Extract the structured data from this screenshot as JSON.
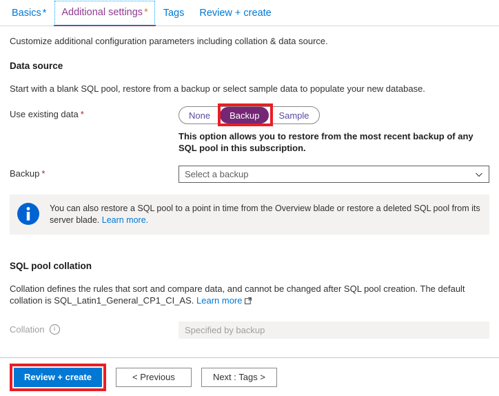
{
  "tabs": [
    {
      "label": "Basics",
      "required": true,
      "selected": false
    },
    {
      "label": "Additional settings",
      "required": true,
      "selected": true
    },
    {
      "label": "Tags",
      "required": false,
      "selected": false
    },
    {
      "label": "Review + create",
      "required": false,
      "selected": false
    }
  ],
  "intro": "Customize additional configuration parameters including collation & data source.",
  "data_source": {
    "heading": "Data source",
    "description": "Start with a blank SQL pool, restore from a backup or select sample data to populate your new database.",
    "use_existing_data": {
      "label": "Use existing data",
      "required_marker": "*",
      "options": [
        "None",
        "Backup",
        "Sample"
      ],
      "selected": "Backup",
      "help_text": "This option allows you to restore from the most recent backup of any SQL pool in this subscription.",
      "highlight_color": "#ec1c24",
      "selected_color": "#742774"
    },
    "backup": {
      "label": "Backup",
      "required_marker": "*",
      "placeholder": "Select a backup",
      "value": "Select a backup",
      "chevron": "chevron-down-icon"
    },
    "info_banner": {
      "icon": "info-icon",
      "icon_color": "#0078d4",
      "text": "You can also restore a SQL pool to a point in time from the Overview blade or restore a deleted SQL pool from its server blade.",
      "link_label": "Learn more."
    }
  },
  "collation_section": {
    "heading": "SQL pool collation",
    "description": "Collation defines the rules that sort and compare data, and cannot be changed after SQL pool creation. The default collation is SQL_Latin1_General_CP1_CI_AS.",
    "link_label": "Learn more",
    "field": {
      "label": "Collation",
      "info_icon": "info-icon",
      "value": "Specified by backup",
      "disabled": true
    }
  },
  "footer": {
    "review_create": "Review + create",
    "previous": "< Previous",
    "next": "Next : Tags >",
    "primary_color": "#0078d4",
    "highlight_color": "#ec1c24"
  }
}
